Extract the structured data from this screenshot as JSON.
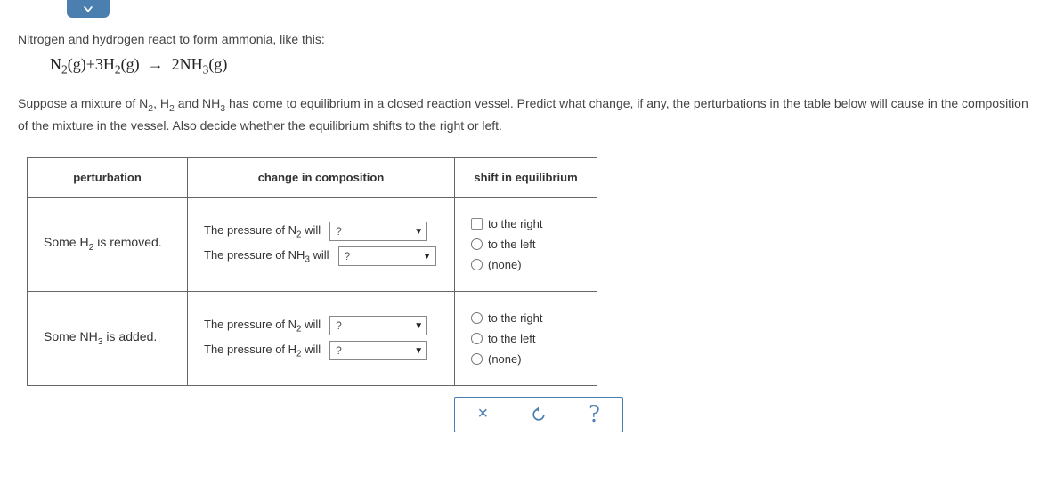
{
  "intro": "Nitrogen and hydrogen react to form ammonia, like this:",
  "equation_html": "N<sub>2</sub>(g)+3H<sub>2</sub>(g)&nbsp;&nbsp;&rarr;&nbsp;&nbsp;2NH<sub>3</sub>(g)",
  "description_html": "Suppose a mixture of N<sub>2</sub>, H<sub>2</sub> and NH<sub>3</sub> has come to equilibrium in a closed reaction vessel. Predict what change, if any, the perturbations in the table below will cause in the composition of the mixture in the vessel. Also decide whether the equilibrium shifts to the right or left.",
  "headers": {
    "perturbation": "perturbation",
    "change": "change in composition",
    "shift": "shift in equilibrium"
  },
  "rows": [
    {
      "perturbation_html": "Some H<sub>2</sub> is removed.",
      "change_lines": [
        {
          "label_html": "The pressure of N<sub>2</sub> will",
          "value": "?"
        },
        {
          "label_html": "The pressure of NH<sub>3</sub> will",
          "value": "?"
        }
      ],
      "shift_options": [
        {
          "label": "to the right",
          "type": "box"
        },
        {
          "label": "to the left",
          "type": "radio"
        },
        {
          "label": "(none)",
          "type": "radio"
        }
      ]
    },
    {
      "perturbation_html": "Some NH<sub>3</sub> is added.",
      "change_lines": [
        {
          "label_html": "The pressure of N<sub>2</sub> will",
          "value": "?"
        },
        {
          "label_html": "The pressure of H<sub>2</sub> will",
          "value": "?"
        }
      ],
      "shift_options": [
        {
          "label": "to the right",
          "type": "radio"
        },
        {
          "label": "to the left",
          "type": "radio"
        },
        {
          "label": "(none)",
          "type": "radio"
        }
      ]
    }
  ],
  "toolbar": {
    "clear": "×",
    "reset": "↺",
    "help": "?"
  }
}
